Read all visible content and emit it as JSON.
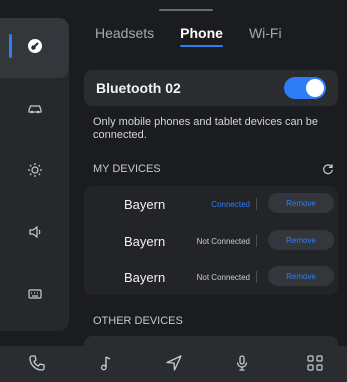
{
  "tabs": [
    {
      "label": "Headsets"
    },
    {
      "label": "Phone"
    },
    {
      "label": "Wi-Fi"
    }
  ],
  "bluetooth": {
    "name": "Bluetooth 02",
    "enabled": true
  },
  "description": "Only mobile phones and tablet devices can be connected.",
  "sections": {
    "my_devices": "MY DEVICES",
    "other_devices": "OTHER DEVICES"
  },
  "devices": [
    {
      "name": "Bayern",
      "status": "Connected",
      "action": "Remove"
    },
    {
      "name": "Bayern",
      "status": "Not Connected",
      "action": "Remove"
    },
    {
      "name": "Bayern",
      "status": "Not Connected",
      "action": "Remove"
    }
  ],
  "colors": {
    "accent": "#2f7df6",
    "bg": "#1b1c1f",
    "panel": "#2a2c30"
  },
  "icons": {
    "rail": [
      "link-icon",
      "car-icon",
      "brightness-icon",
      "volume-icon",
      "keyboard-icon"
    ],
    "bottom": [
      "phone-icon",
      "music-icon",
      "navigation-icon",
      "microphone-icon",
      "apps-grid-icon"
    ]
  }
}
